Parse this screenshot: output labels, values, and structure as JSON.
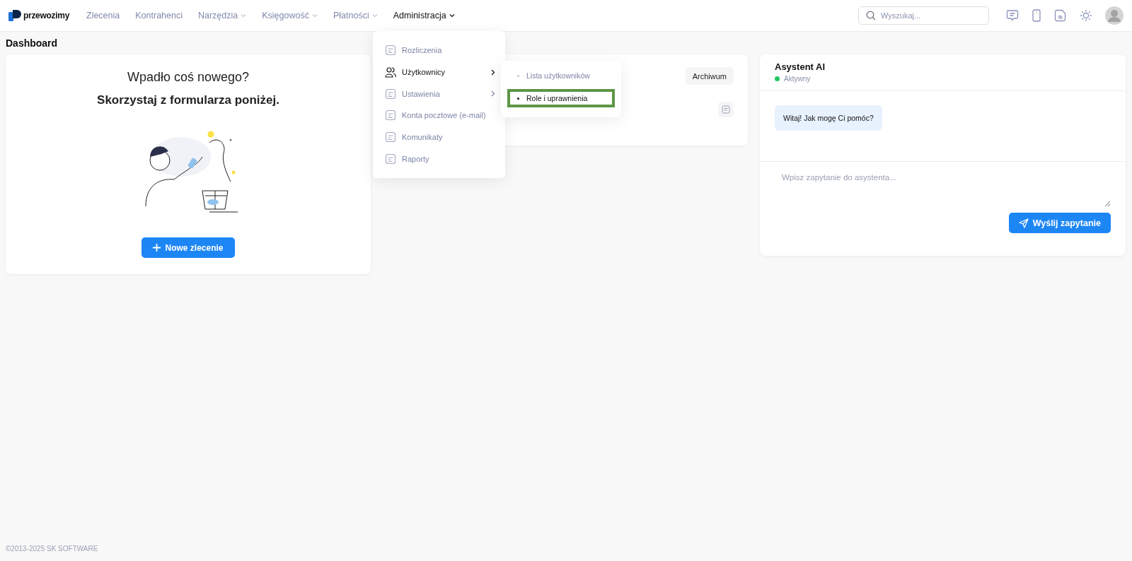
{
  "brand": "przewozimy",
  "nav": [
    {
      "label": "Zlecenia",
      "dropdown": false,
      "selected": false
    },
    {
      "label": "Kontrahenci",
      "dropdown": false,
      "selected": false
    },
    {
      "label": "Narzędzia",
      "dropdown": true,
      "selected": false
    },
    {
      "label": "Księgowość",
      "dropdown": true,
      "selected": false
    },
    {
      "label": "Płatności",
      "dropdown": true,
      "selected": false
    },
    {
      "label": "Administracja",
      "dropdown": true,
      "selected": true
    }
  ],
  "search": {
    "placeholder": "Wyszukaj..."
  },
  "page_title": "Dashboard",
  "welcome": {
    "line1": "Wpadło coś nowego?",
    "line2": "Skorzystaj z formularza poniżej.",
    "button": "Nowe zlecenie"
  },
  "middle_card": {
    "button": "Archiwum"
  },
  "assistant": {
    "title": "Asystent AI",
    "status": {
      "label": "Aktywny",
      "color": "#22c55e"
    },
    "message": "Witaj! Jak mogę Ci pomóc?",
    "placeholder": "Wpisz zapytanie do asystenta...",
    "send": "Wyślij zapytanie"
  },
  "admin_menu": [
    {
      "label": "Rozliczenia",
      "submenu": false,
      "selected": false
    },
    {
      "label": "Użytkownicy",
      "submenu": true,
      "selected": true
    },
    {
      "label": "Ustawienia",
      "submenu": true,
      "selected": false
    },
    {
      "label": "Konta pocztowe (e-mail)",
      "submenu": false,
      "selected": false
    },
    {
      "label": "Komunikaty",
      "submenu": false,
      "selected": false
    },
    {
      "label": "Raporty",
      "submenu": false,
      "selected": false
    }
  ],
  "submenu": [
    {
      "label": "Lista użytkowników",
      "selected": false
    },
    {
      "label": "Role i uprawnienia",
      "selected": true
    }
  ],
  "footer": "©2013-2025  SK SOFTWARE"
}
